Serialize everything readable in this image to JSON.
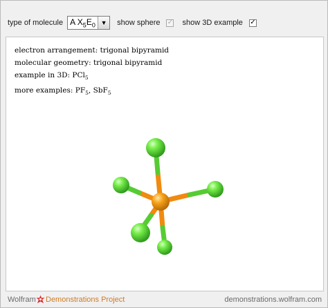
{
  "controls": {
    "molecule_type_label": "type of molecule",
    "molecule_type_value": {
      "pre": "A X",
      "sub1": "5",
      "mid": "E",
      "sub2": "0"
    },
    "show_sphere_label": "show sphere",
    "show_sphere_checked": true,
    "show_sphere_enabled": false,
    "show_3d_label": "show 3D example",
    "show_3d_checked": true
  },
  "info": {
    "electron_arrangement": "electron arrangement: trigonal bipyramid",
    "molecular_geometry": "molecular geometry: trigonal bipyramid",
    "example_3d": {
      "prefix": "example in 3D: PCl",
      "sub": "5"
    },
    "more_examples": {
      "prefix": "more examples: PF",
      "sub1": "5",
      "sep": ", SbF",
      "sub2": "5"
    }
  },
  "molecule": {
    "central_atom_color": "#f39c12",
    "ligand_color": "#5ddc3a",
    "bond_color_central": "#f08a10",
    "bond_color_ligand": "#55cc33"
  },
  "footer": {
    "brand": "Wolfram",
    "project": "Demonstrations Project",
    "url": "demonstrations.wolfram.com"
  }
}
